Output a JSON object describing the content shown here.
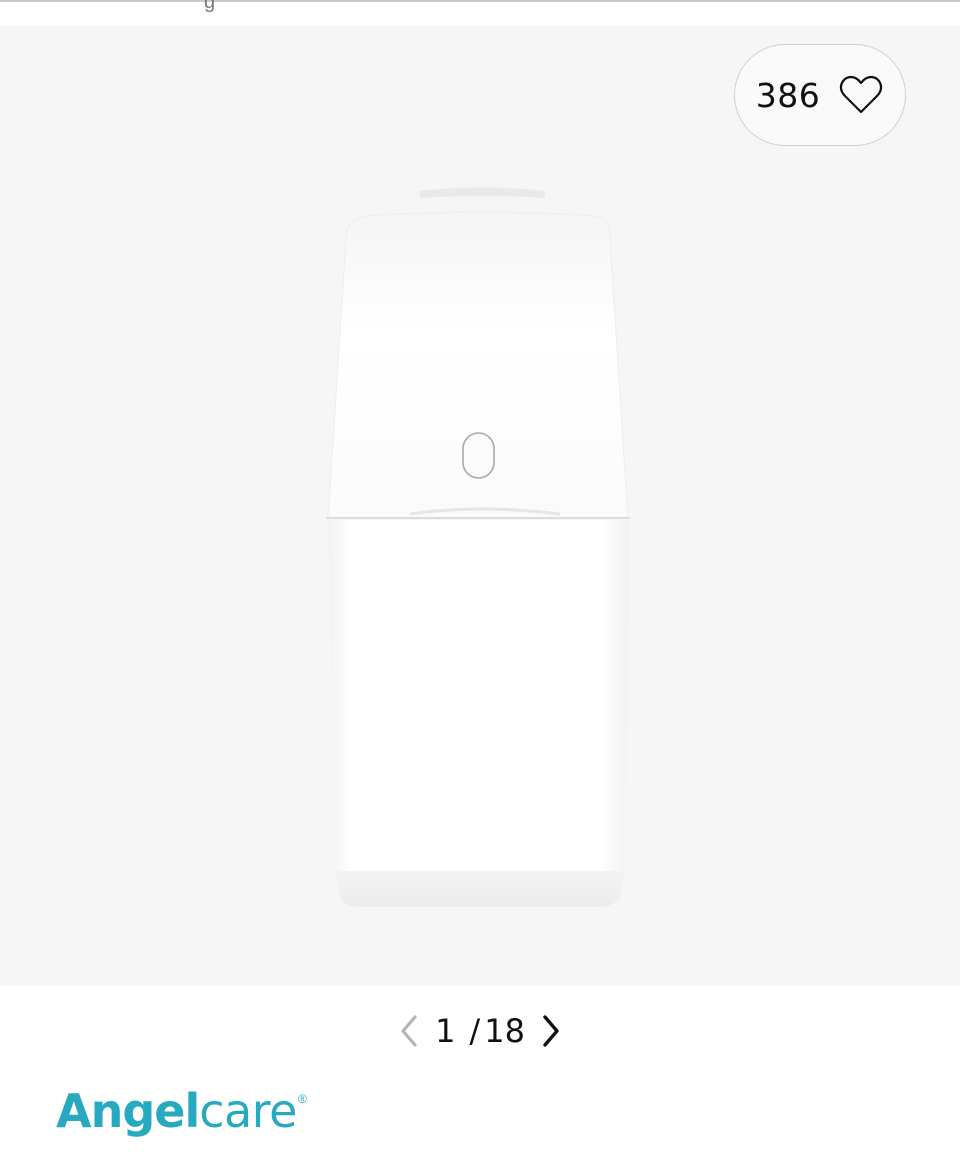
{
  "header": {
    "truncated_text": "g"
  },
  "gallery": {
    "image_alt": "Angelcare diaper disposal bin, white",
    "likes": {
      "count": "386",
      "icon": "heart-outline-icon"
    },
    "pagination": {
      "current": "1",
      "separator": "/",
      "total": "18",
      "prev_icon": "chevron-left-icon",
      "next_icon": "chevron-right-icon"
    }
  },
  "brand": {
    "name_bold": "Angel",
    "name_light": "care",
    "registered": "®",
    "color": "#27a9bf"
  }
}
